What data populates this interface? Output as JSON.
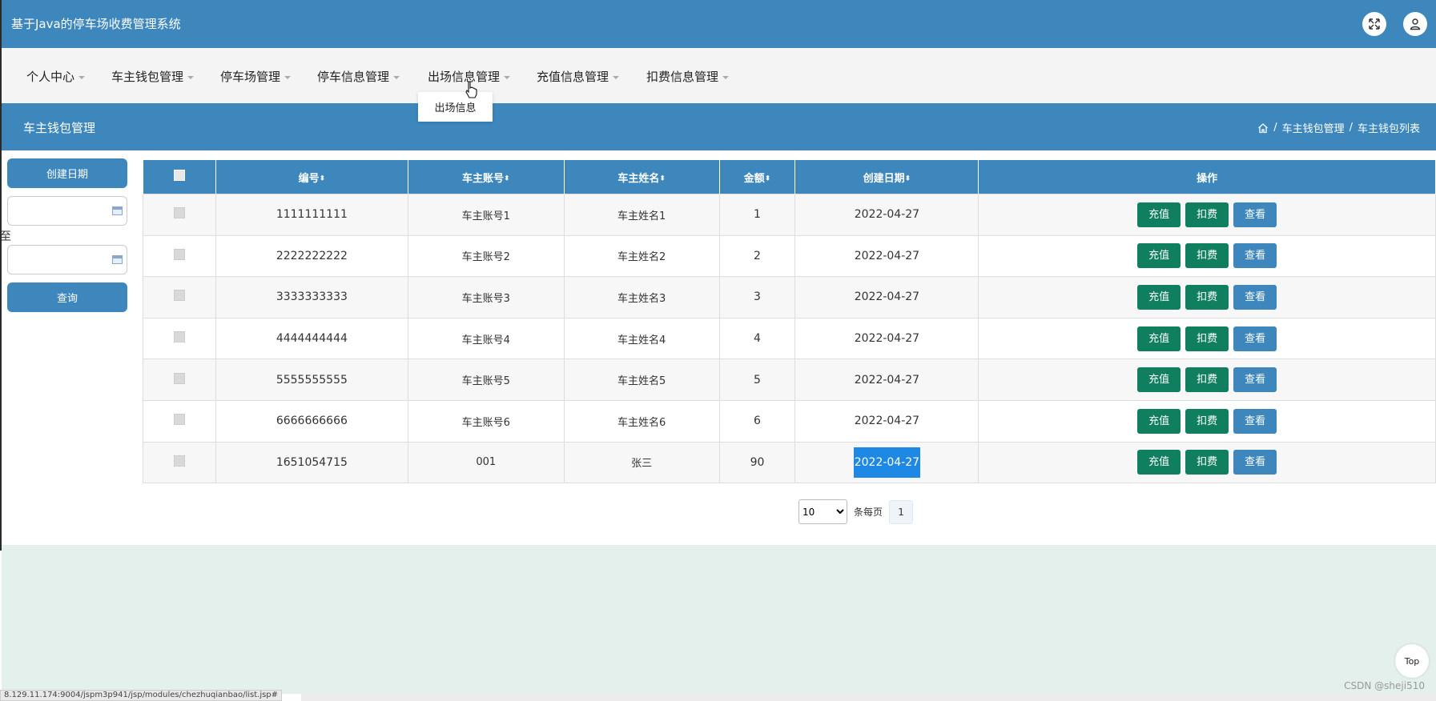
{
  "header": {
    "title": "基于Java的停车场收费管理系统"
  },
  "nav": {
    "items": [
      {
        "label": "个人中心"
      },
      {
        "label": "车主钱包管理"
      },
      {
        "label": "停车场管理"
      },
      {
        "label": "停车信息管理"
      },
      {
        "label": "出场信息管理"
      },
      {
        "label": "充值信息管理"
      },
      {
        "label": "扣费信息管理"
      }
    ],
    "dropdown_item": "出场信息"
  },
  "section": {
    "title": "车主钱包管理",
    "breadcrumb": [
      "车主钱包管理",
      "车主钱包列表"
    ],
    "breadcrumb_sep": "/"
  },
  "filter": {
    "date_label": "创建日期",
    "separator": "至",
    "query_label": "查询"
  },
  "table": {
    "headers": [
      "编号",
      "车主账号",
      "车主姓名",
      "金额",
      "创建日期",
      "操作"
    ],
    "sort_glyph": "⬍",
    "rows": [
      {
        "id": "1111111111",
        "account": "车主账号1",
        "name": "车主姓名1",
        "amount": "1",
        "date": "2022-04-27"
      },
      {
        "id": "2222222222",
        "account": "车主账号2",
        "name": "车主姓名2",
        "amount": "2",
        "date": "2022-04-27"
      },
      {
        "id": "3333333333",
        "account": "车主账号3",
        "name": "车主姓名3",
        "amount": "3",
        "date": "2022-04-27"
      },
      {
        "id": "4444444444",
        "account": "车主账号4",
        "name": "车主姓名4",
        "amount": "4",
        "date": "2022-04-27"
      },
      {
        "id": "5555555555",
        "account": "车主账号5",
        "name": "车主姓名5",
        "amount": "5",
        "date": "2022-04-27"
      },
      {
        "id": "6666666666",
        "account": "车主账号6",
        "name": "车主姓名6",
        "amount": "6",
        "date": "2022-04-27"
      },
      {
        "id": "1651054715",
        "account": "001",
        "name": "张三",
        "amount": "90",
        "date": "2022-04-27",
        "selected": true
      }
    ],
    "actions": {
      "recharge": "充值",
      "deduct": "扣费",
      "view": "查看"
    }
  },
  "pager": {
    "page_size": "10",
    "per_page_label": "条每页",
    "current_page": "1"
  },
  "misc": {
    "top_label": "Top",
    "status_url": "8.129.11.174:9004/jspm3p941/jsp/modules/chezhuqianbao/list.jsp#",
    "watermark": "CSDN @sheji510"
  },
  "colors": {
    "primary": "#3d87bd",
    "action_green": "#107f5f",
    "bottom_bg": "#e3f0ec"
  },
  "icons": [
    "fullscreen-icon",
    "user-icon",
    "home-icon",
    "calendar-icon",
    "pointer-cursor-icon"
  ]
}
